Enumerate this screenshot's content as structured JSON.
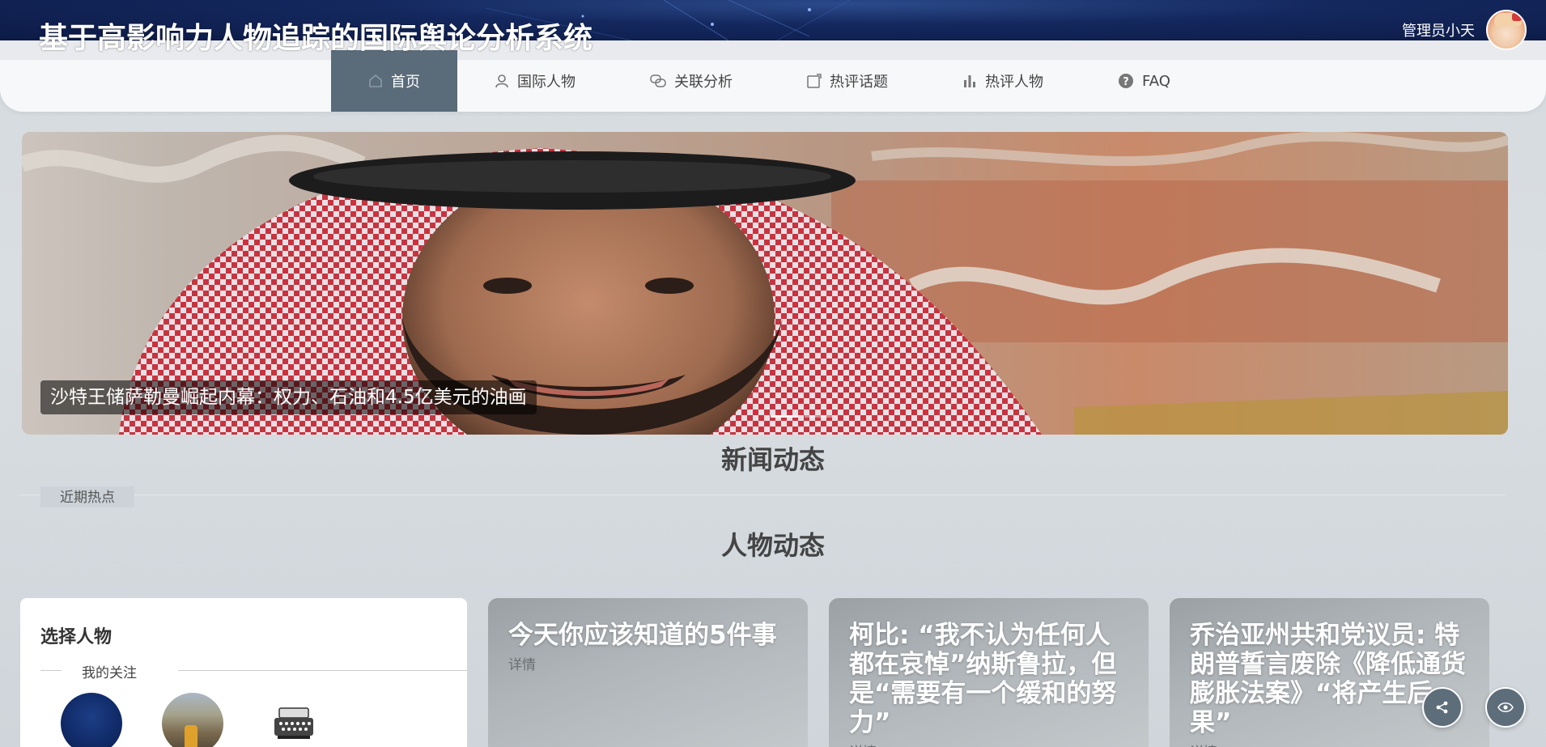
{
  "header": {
    "title": "基于高影响力人物追踪的国际舆论分析系统",
    "user_name": "管理员小天",
    "banner_color": "#14285e"
  },
  "nav": {
    "items": [
      {
        "label": "首页",
        "icon": "home-icon",
        "active": true
      },
      {
        "label": "国际人物",
        "icon": "user-icon",
        "active": false
      },
      {
        "label": "关联分析",
        "icon": "chat-icon",
        "active": false
      },
      {
        "label": "热评话题",
        "icon": "edit-icon",
        "active": false
      },
      {
        "label": "热评人物",
        "icon": "bar-chart-icon",
        "active": false
      },
      {
        "label": "FAQ",
        "icon": "question-icon",
        "active": false
      }
    ],
    "active_color": "#5a6b7a"
  },
  "carousel": {
    "caption": "沙特王储萨勒曼崛起内幕：权力、石油和4.5亿美元的油画",
    "slide_count": 2,
    "active_index": 0
  },
  "news_section": {
    "title": "新闻动态",
    "tag": "近期热点"
  },
  "people_section": {
    "title": "人物动态",
    "select_card": {
      "title": "选择人物",
      "follow_label": "我的关注",
      "avatars": [
        "person-avatar-1",
        "person-avatar-2",
        "person-avatar-3"
      ]
    },
    "cards": [
      {
        "title": "今天你应该知道的5件事",
        "link": "详情"
      },
      {
        "title": "柯比: “我不认为任何人都在哀悼”纳斯鲁拉，但是“需要有一个缓和的努力”",
        "link": "详情"
      },
      {
        "title": "乔治亚州共和党议员: 特朗普誓言废除《降低通货膨胀法案》“将产生后果”",
        "link": "详情"
      }
    ]
  },
  "floating": {
    "share_icon": "share-icon",
    "eye_icon": "eye-icon"
  }
}
